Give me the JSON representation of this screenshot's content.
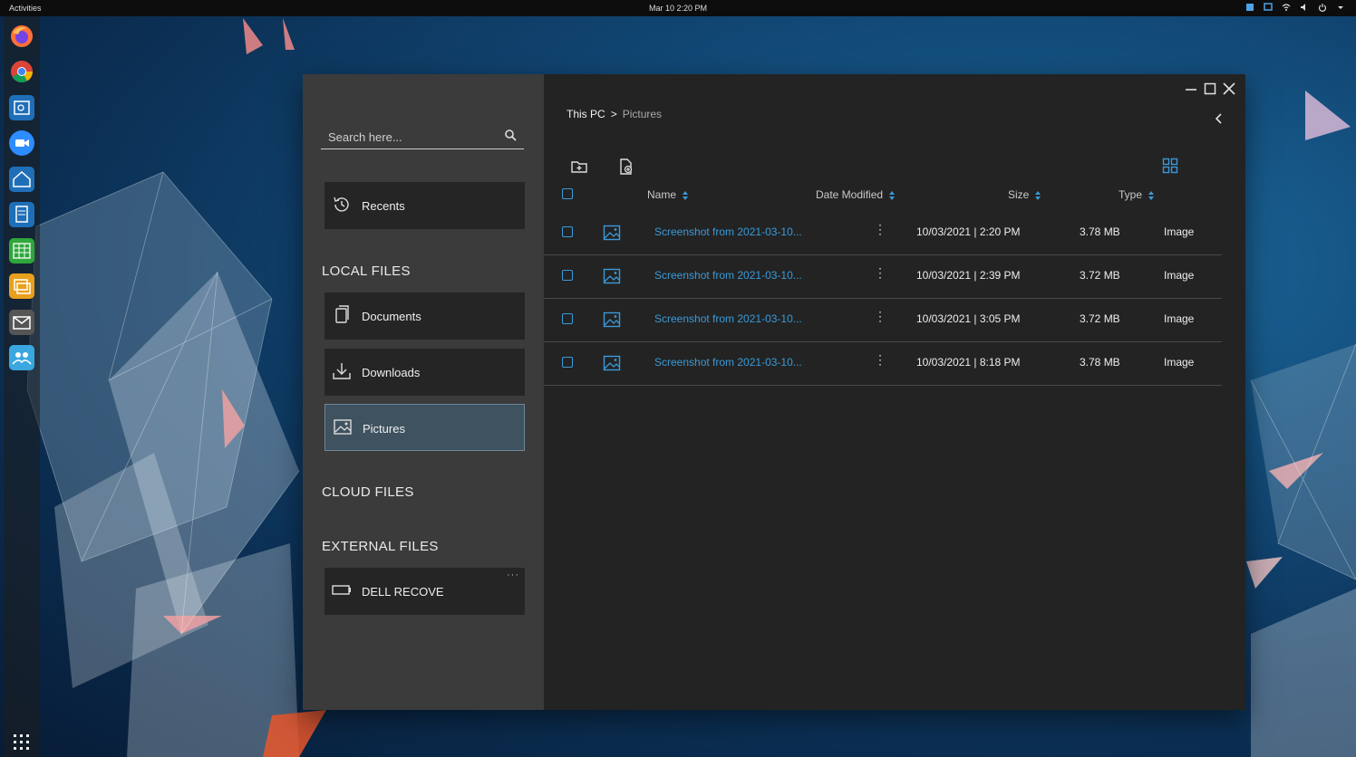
{
  "topbar": {
    "activities": "Activities",
    "clock": "Mar 10  2:20 PM"
  },
  "colors": {
    "accent": "#3a9ad9",
    "sidebar_bg": "#3b3b3b",
    "window_bg": "#232323",
    "active_nav_bg": "#3f5260"
  },
  "dock": {
    "apps": [
      "firefox-icon",
      "chrome-icon",
      "file-manager-icon",
      "zoom-icon",
      "home-app-icon",
      "document-viewer-icon",
      "spreadsheet-icon",
      "slides-icon",
      "mail-icon",
      "team-icon"
    ],
    "grid": "app-grid-icon"
  },
  "sidebar": {
    "search_placeholder": "Search here...",
    "recents_label": "Recents",
    "local_files_title": "LOCAL FILES",
    "local_items": [
      {
        "label": "Documents",
        "icon": "document-icon"
      },
      {
        "label": "Downloads",
        "icon": "download-icon"
      },
      {
        "label": "Pictures",
        "icon": "picture-icon",
        "active": true
      }
    ],
    "cloud_files_title": "CLOUD FILES",
    "external_files_title": "EXTERNAL FILES",
    "external_items": [
      {
        "label": "DELL RECOVE",
        "icon": "drive-icon",
        "more": "···"
      }
    ]
  },
  "breadcrumb": {
    "home": "This PC",
    "separator": ">",
    "current": "Pictures"
  },
  "table": {
    "columns": [
      "Name",
      "Date Modified",
      "Size",
      "Type"
    ],
    "rows": [
      {
        "name": "Screenshot from 2021-03-10...",
        "date": "10/03/2021 | 2:20 PM",
        "size": "3.78 MB",
        "type": "Image"
      },
      {
        "name": "Screenshot from 2021-03-10...",
        "date": "10/03/2021 | 2:39 PM",
        "size": "3.72 MB",
        "type": "Image"
      },
      {
        "name": "Screenshot from 2021-03-10...",
        "date": "10/03/2021 | 3:05 PM",
        "size": "3.72 MB",
        "type": "Image"
      },
      {
        "name": "Screenshot from 2021-03-10...",
        "date": "10/03/2021 | 8:18 PM",
        "size": "3.78 MB",
        "type": "Image"
      }
    ]
  }
}
